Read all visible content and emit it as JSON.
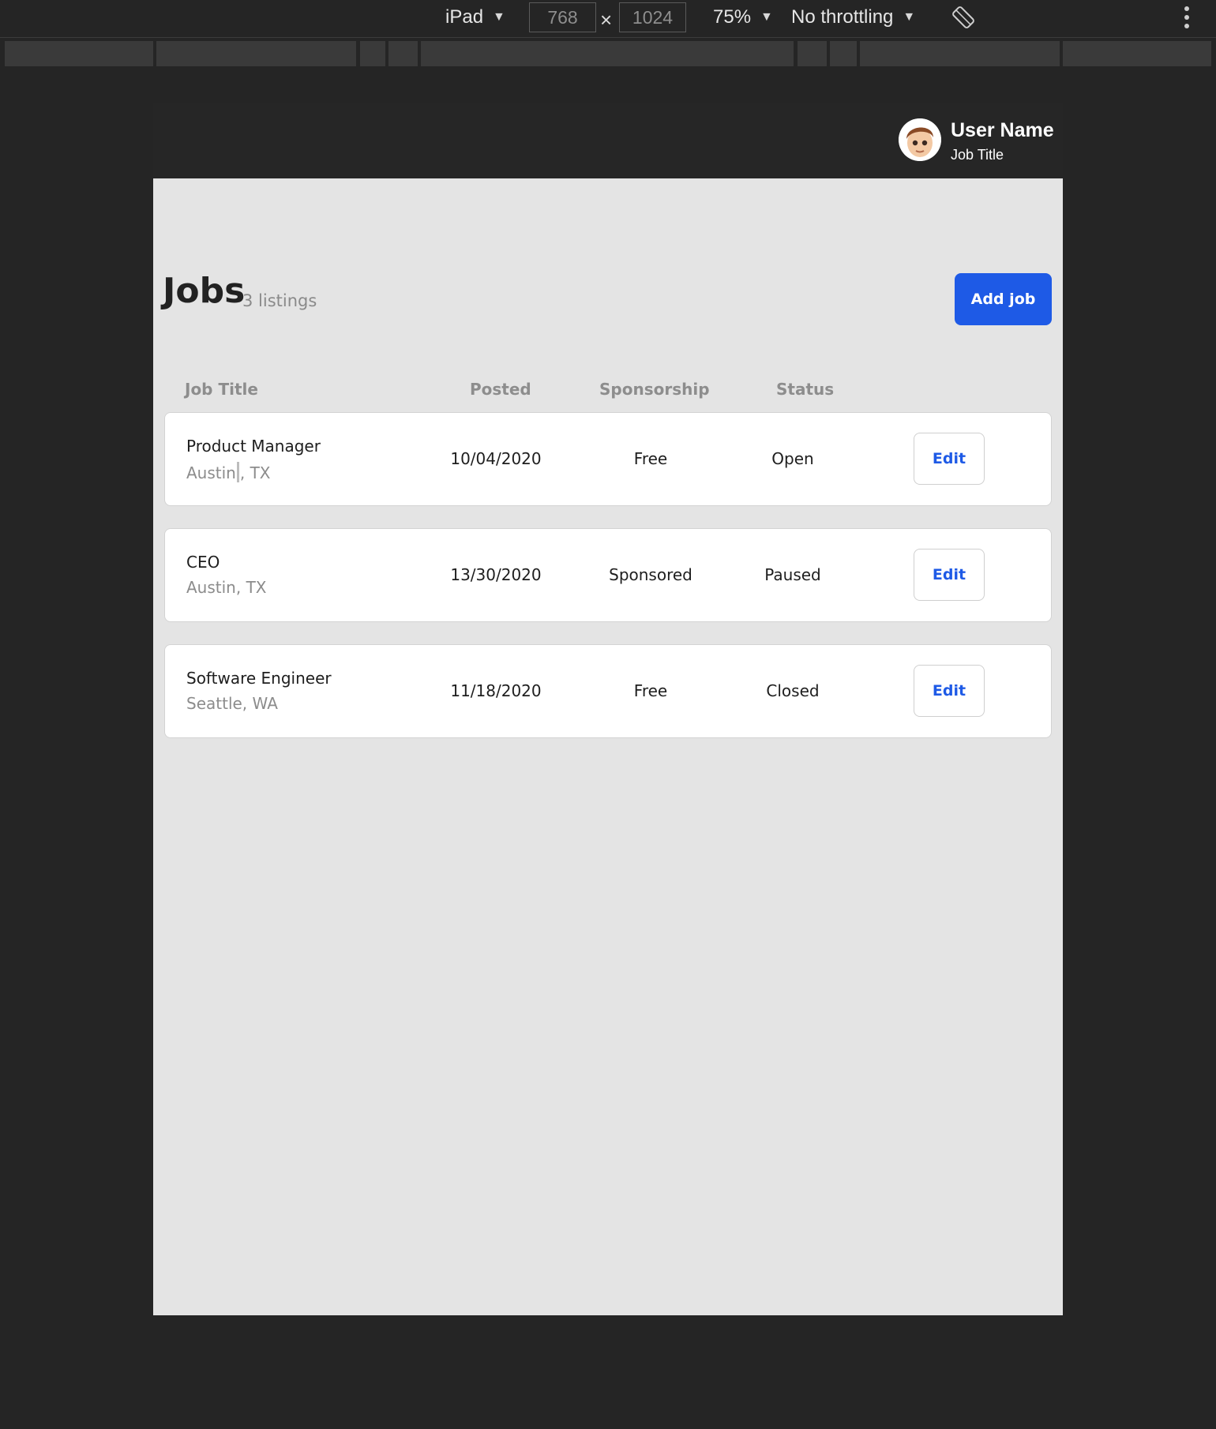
{
  "devtools": {
    "device": "iPad",
    "width": "768",
    "height": "1024",
    "times": "×",
    "zoom": "75%",
    "throttling": "No throttling"
  },
  "header": {
    "user_name": "User Name",
    "user_title": "Job Title"
  },
  "page": {
    "title": "Jobs",
    "count": "3 listings",
    "add_label": "Add job"
  },
  "columns": {
    "title": "Job Title",
    "posted": "Posted",
    "sponsorship": "Sponsorship",
    "status": "Status"
  },
  "jobs": [
    {
      "title": "Product Manager",
      "location": "Austin, TX",
      "location_a": "Austin",
      "location_b": ", TX",
      "posted": "10/04/2020",
      "sponsorship": "Free",
      "status": "Open",
      "edit_label": "Edit"
    },
    {
      "title": "CEO",
      "location": "Austin, TX",
      "posted": "13/30/2020",
      "sponsorship": "Sponsored",
      "status": "Paused",
      "edit_label": "Edit"
    },
    {
      "title": "Software Engineer",
      "location": "Seattle, WA",
      "posted": "11/18/2020",
      "sponsorship": "Free",
      "status": "Closed",
      "edit_label": "Edit"
    }
  ],
  "icons": {
    "caret": "dropdown-caret",
    "rotate": "rotate-icon",
    "menu": "kebab-menu-icon"
  },
  "colors": {
    "accent": "#1e5ae6",
    "header_bg": "#262626",
    "page_bg": "#e4e4e4"
  }
}
